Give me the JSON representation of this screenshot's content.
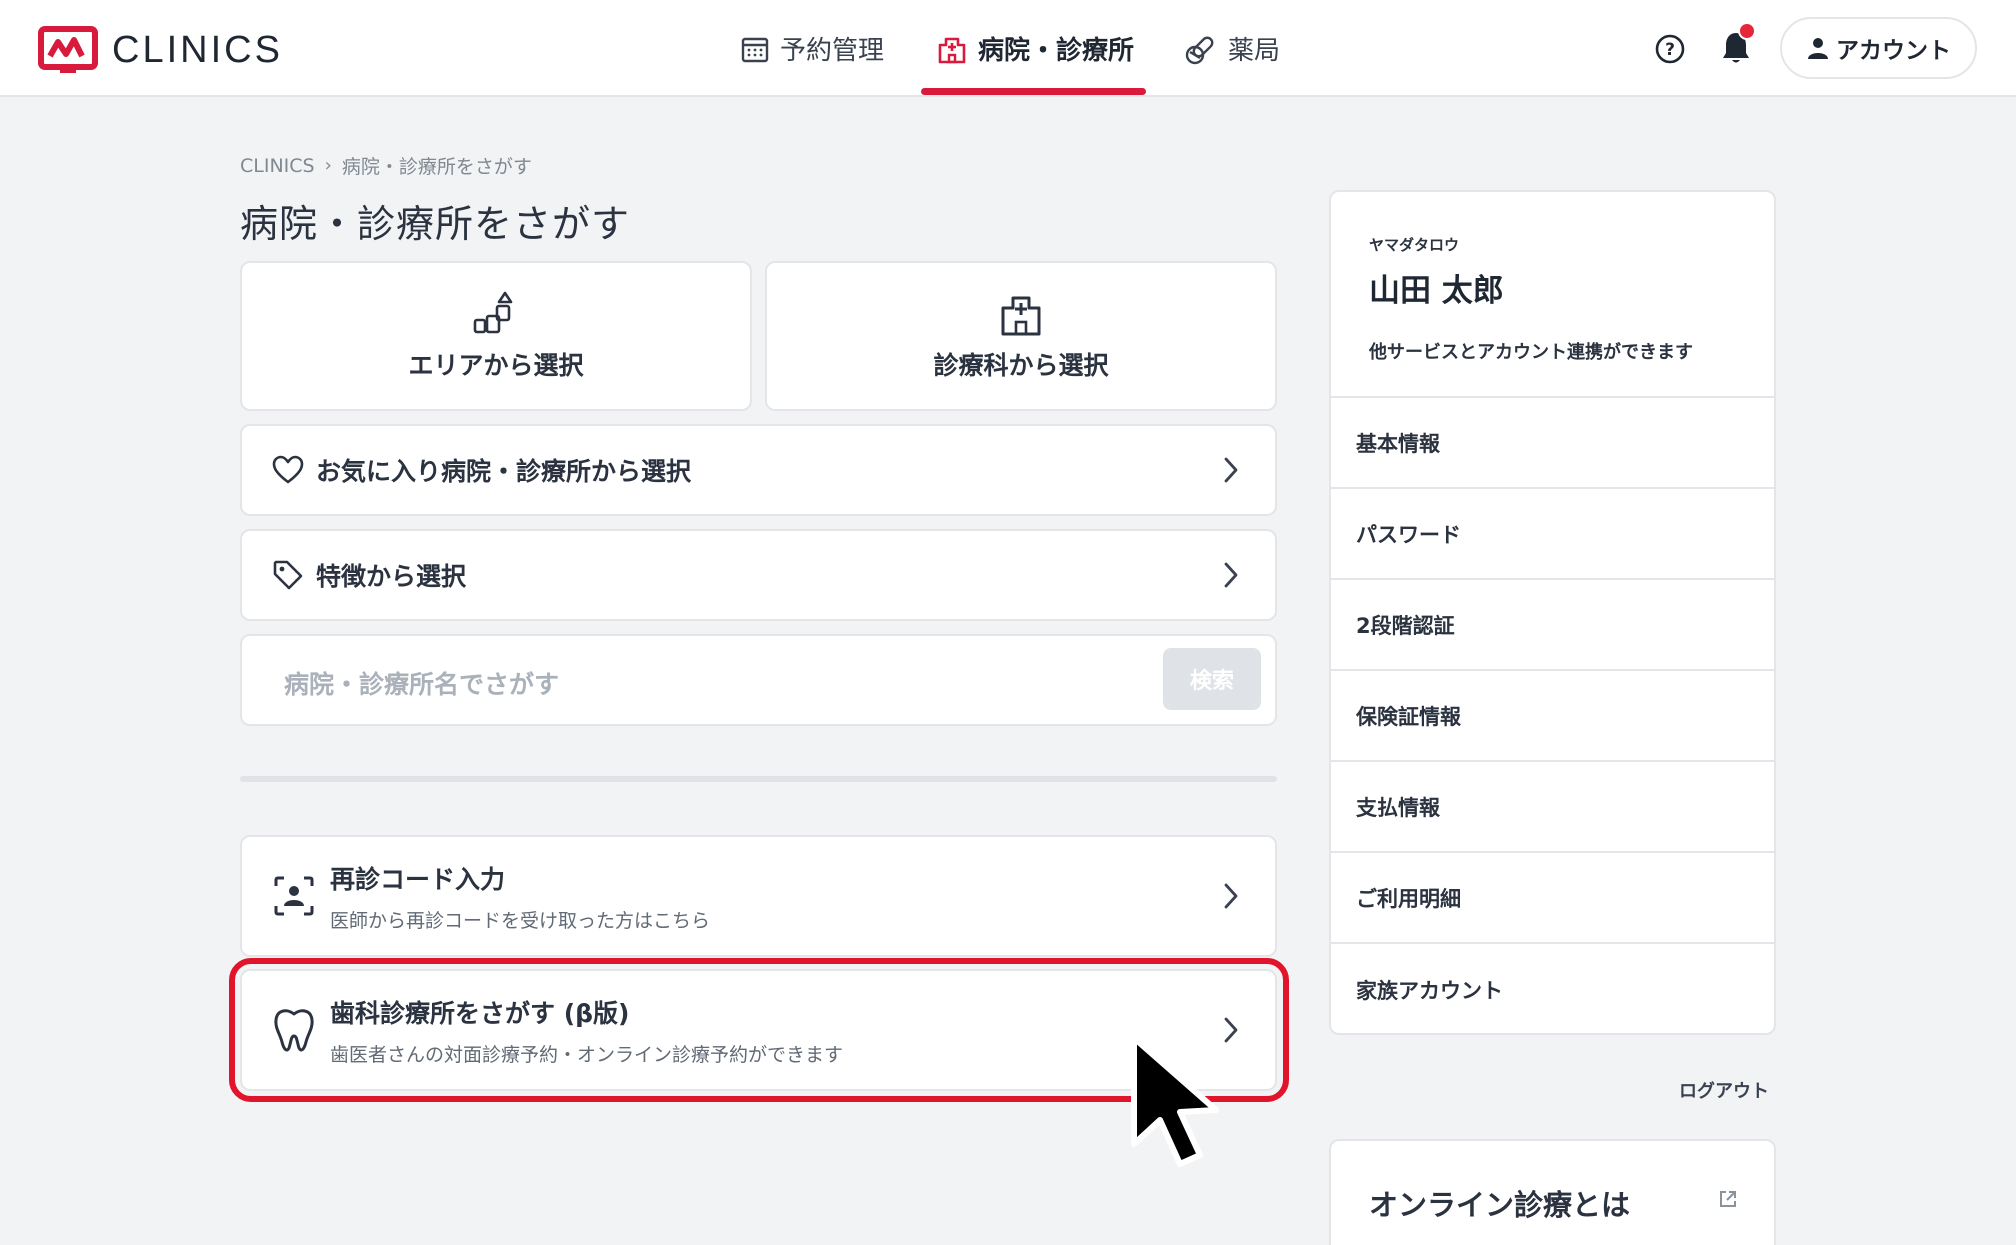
{
  "colors": {
    "accent": "#d81b3c",
    "highlight": "#e0142b",
    "background": "#f2f3f5"
  },
  "header": {
    "logo_text": "CLINICS",
    "nav": [
      {
        "label": "予約管理",
        "icon": "calendar-icon"
      },
      {
        "label": "病院・診療所",
        "icon": "hospital-icon",
        "active": true
      },
      {
        "label": "薬局",
        "icon": "pill-icon"
      }
    ],
    "account_label": "アカウント"
  },
  "breadcrumb": {
    "root": "CLINICS",
    "separator": "›",
    "current": "病院・診療所をさがす"
  },
  "page_title": "病院・診療所をさがす",
  "tiles": [
    {
      "label": "エリアから選択",
      "icon": "area-blocks-icon"
    },
    {
      "label": "診療科から選択",
      "icon": "hospital-building-icon"
    }
  ],
  "rows": [
    {
      "label": "お気に入り病院・診療所から選択",
      "icon": "heart-icon"
    },
    {
      "label": "特徴から選択",
      "icon": "tag-icon"
    }
  ],
  "search": {
    "placeholder": "病院・診療所名でさがす",
    "button_label": "検索"
  },
  "revisit": {
    "title": "再診コード入力",
    "subtitle": "医師から再診コードを受け取った方はこちら",
    "icon": "face-scan-icon"
  },
  "dental": {
    "title": "歯科診療所をさがす (β版)",
    "subtitle": "歯医者さんの対面診療予約・オンライン診療予約ができます",
    "icon": "tooth-icon"
  },
  "profile": {
    "kana": "ヤマダタロウ",
    "name": "山田 太郎",
    "link_text": "他サービスとアカウント連携ができます"
  },
  "menu": [
    "基本情報",
    "パスワード",
    "2段階認証",
    "保険証情報",
    "支払情報",
    "ご利用明細",
    "家族アカウント"
  ],
  "logout_label": "ログアウト",
  "online": {
    "title": "オンライン診療とは",
    "icon": "external-link-icon"
  }
}
